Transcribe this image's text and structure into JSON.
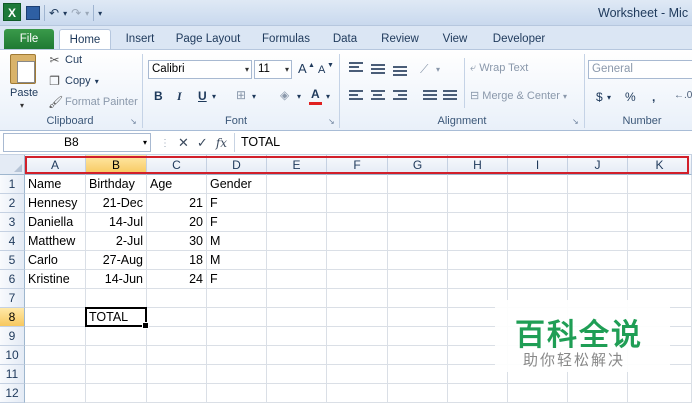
{
  "app": {
    "logo_letter": "X",
    "window_title": "Worksheet - Mic"
  },
  "qat": {
    "undo_icon": "↶",
    "redo_icon": "↷",
    "dropdown_icon": "▾",
    "customize_icon": "▾"
  },
  "ribbon_tabs": [
    "File",
    "Home",
    "Insert",
    "Page Layout",
    "Formulas",
    "Data",
    "Review",
    "View",
    "Developer"
  ],
  "clipboard": {
    "paste_label": "Paste",
    "cut_label": "Cut",
    "copy_label": "Copy",
    "format_painter_label": "Format Painter",
    "group_label": "Clipboard"
  },
  "font": {
    "font_name": "Calibri",
    "font_size": "11",
    "bold": "B",
    "italic": "I",
    "underline": "U",
    "grow": "A",
    "shrink": "A",
    "font_color_letter": "A",
    "group_label": "Font"
  },
  "alignment": {
    "wrap_text_label": "Wrap Text",
    "merge_center_label": "Merge & Center",
    "group_label": "Alignment"
  },
  "number": {
    "format_value": "General",
    "currency": "$",
    "percent": "%",
    "comma": ",",
    "group_label": "Number"
  },
  "formula_bar": {
    "name_box": "B8",
    "cancel": "✕",
    "enter": "✓",
    "fx": "fx",
    "formula": "TOTAL"
  },
  "sheet": {
    "columns": [
      "A",
      "B",
      "C",
      "D",
      "E",
      "F",
      "G",
      "H",
      "I",
      "J",
      "K"
    ],
    "rows": [
      "1",
      "2",
      "3",
      "4",
      "5",
      "6",
      "7",
      "8",
      "9",
      "10",
      "11",
      "12"
    ],
    "header_row": [
      "Name",
      "Birthday",
      "Age",
      "Gender"
    ],
    "data": [
      [
        "Hennesy",
        "21-Dec",
        "21",
        "F"
      ],
      [
        "Daniella",
        "14-Jul",
        "20",
        "F"
      ],
      [
        "Matthew",
        "2-Jul",
        "30",
        "M"
      ],
      [
        "Carlo",
        "27-Aug",
        "18",
        "M"
      ],
      [
        "Kristine",
        "14-Jun",
        "24",
        "F"
      ]
    ],
    "total_label": "TOTAL",
    "active_cell": "B8",
    "highlight_color": "#d21f2a"
  },
  "watermark": {
    "title": "百科全说",
    "subtitle": "助你轻松解决",
    "color": "#1f9e55"
  }
}
